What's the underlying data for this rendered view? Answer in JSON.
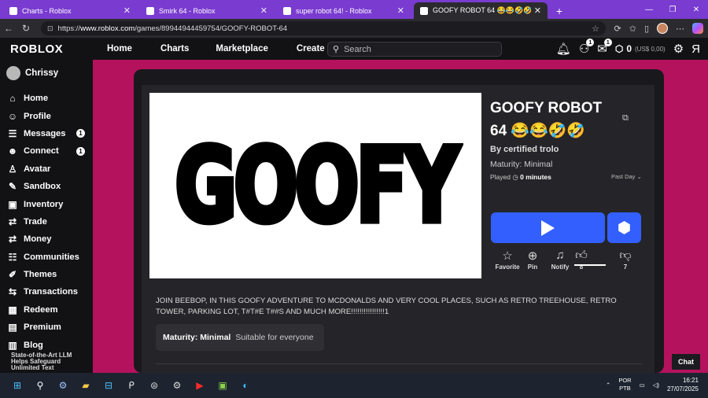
{
  "browser": {
    "tabs": [
      {
        "title": "Charts - Roblox",
        "active": false
      },
      {
        "title": "Smirk 64 - Roblox",
        "active": false
      },
      {
        "title": "super robot 64! - Roblox",
        "active": false
      },
      {
        "title": "GOOFY ROBOT 64 😂😂🤣🤣 - Roblox",
        "active": true
      }
    ],
    "url_prefix": "https://",
    "url_host": "www.roblox.com",
    "url_path": "/games/89944944459754/GOOFY-ROBOT-64"
  },
  "roblox": {
    "logo": "ROBLOX",
    "topnav": [
      "Home",
      "Charts",
      "Marketplace",
      "Create"
    ],
    "search_placeholder": "Search",
    "friends_badge": "1",
    "messages_badge": "1",
    "robux": "0",
    "robux_usd": "(US$ 0,00)"
  },
  "sidebar": {
    "username": "Chrissy",
    "items": [
      {
        "label": "Home",
        "icon": "home-icon",
        "glyph": "⌂"
      },
      {
        "label": "Profile",
        "icon": "profile-icon",
        "glyph": "☺"
      },
      {
        "label": "Messages",
        "icon": "messages-icon",
        "glyph": "☰",
        "count": "1"
      },
      {
        "label": "Connect",
        "icon": "connect-icon",
        "glyph": "☻",
        "count": "1"
      },
      {
        "label": "Avatar",
        "icon": "avatar-icon",
        "glyph": "♙"
      },
      {
        "label": "Sandbox",
        "icon": "sandbox-icon",
        "glyph": "✎"
      },
      {
        "label": "Inventory",
        "icon": "inventory-icon",
        "glyph": "▣"
      },
      {
        "label": "Trade",
        "icon": "trade-icon",
        "glyph": "⇄"
      },
      {
        "label": "Money",
        "icon": "money-icon",
        "glyph": "⇄"
      },
      {
        "label": "Communities",
        "icon": "communities-icon",
        "glyph": "☷"
      },
      {
        "label": "Themes",
        "icon": "themes-icon",
        "glyph": "✐"
      },
      {
        "label": "Transactions",
        "icon": "transactions-icon",
        "glyph": "⇆"
      },
      {
        "label": "Redeem",
        "icon": "redeem-icon",
        "glyph": "▦"
      },
      {
        "label": "Premium",
        "icon": "premium-icon",
        "glyph": "▤"
      },
      {
        "label": "Blog",
        "icon": "blog-icon",
        "glyph": "▥"
      }
    ],
    "ad_text": "State-of-the-Art LLM Helps Safeguard Unlimited Text"
  },
  "game": {
    "thumbnail_text": "GOOFY",
    "title": "GOOFY ROBOT 64 😂😂🤣🤣",
    "by": "By certified trolo",
    "maturity": "Maturity: Minimal",
    "played_label": "Played",
    "played_value": "0 minutes",
    "period": "Past Day",
    "actions": {
      "favorite": "Favorite",
      "pin": "Pin",
      "notify": "Notify",
      "likes": "8",
      "dislikes": "7"
    },
    "description": "JOIN BEEBOP, IN THIS GOOFY ADVENTURE TO MCDONALDS AND VERY COOL PLACES, SUCH AS RETRO TREEHOUSE, RETRO TOWER, PARKING LOT, T#T#E T##S AND MUCH MORE!!!!!!!!!!!!!!!!1",
    "maturity_box_label": "Maturity: Minimal",
    "maturity_box_text": "Suitable for everyone"
  },
  "chat_label": "Chat",
  "taskbar": {
    "lang_top": "POR",
    "lang_bottom": "PTB",
    "time": "16:21",
    "date": "27/07/2025"
  },
  "colors": {
    "accent": "#335fff",
    "page_bg": "#b5125e",
    "tabbar": "#7a3bd0"
  }
}
